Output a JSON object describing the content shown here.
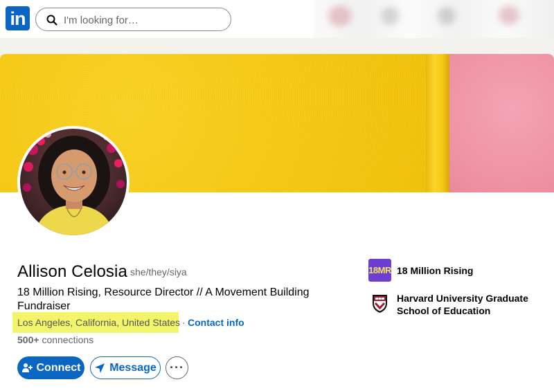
{
  "nav": {
    "logo_text": "in",
    "search_placeholder": "I'm looking for…"
  },
  "profile": {
    "name": "Allison Celosia",
    "pronouns": "she/they/siya",
    "headline": "18 Million Rising, Resource Director // A Movement Building Fundraiser",
    "location": "Los Angeles, California, United States",
    "separator": "·",
    "contact_info": "Contact info",
    "connections_count": "500+",
    "connections_label": "connections"
  },
  "actions": {
    "connect": "Connect",
    "message": "Message",
    "more": "···"
  },
  "organizations": [
    {
      "logo_text": "18MR",
      "name": "18 Million Rising"
    },
    {
      "logo_text": "",
      "name": "Harvard University Graduate School of Education"
    }
  ],
  "colors": {
    "brand": "#0a66c2",
    "highlight": "#f2f56a",
    "cover_yellow": "#f7cb18",
    "cover_pink": "#ef95a6",
    "org_purple": "#6a3fd1",
    "harvard_crimson": "#a51c30"
  },
  "icons": {
    "search": "search-icon",
    "connect": "add-person-icon",
    "message": "send-icon",
    "more": "ellipsis-icon"
  }
}
